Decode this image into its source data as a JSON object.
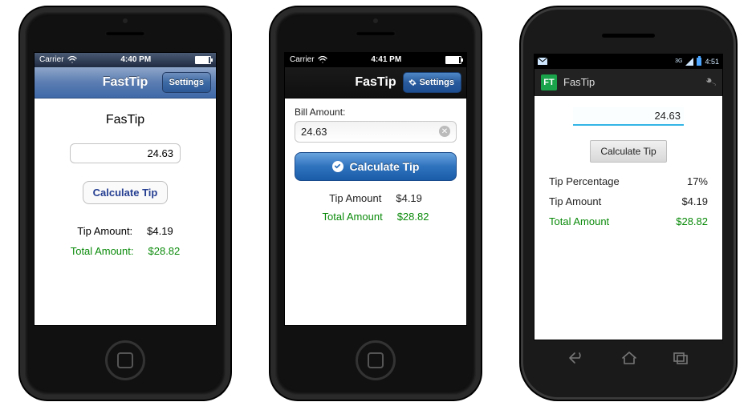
{
  "ios_old": {
    "carrier": "Carrier",
    "time": "4:40 PM",
    "nav_title": "FastTip",
    "settings_label": "Settings",
    "page_title": "FasTip",
    "bill_value": "24.63",
    "calc_label": "Calculate Tip",
    "tip_label": "Tip Amount:",
    "tip_value": "$4.19",
    "total_label": "Total Amount:",
    "total_value": "$28.82"
  },
  "ios_new": {
    "carrier": "Carrier",
    "time": "4:41 PM",
    "nav_title": "FasTip",
    "settings_label": "Settings",
    "bill_label": "Bill Amount:",
    "bill_value": "24.63",
    "calc_label": "Calculate Tip",
    "tip_label": "Tip Amount",
    "tip_value": "$4.19",
    "total_label": "Total Amount",
    "total_value": "$28.82"
  },
  "android": {
    "time": "4:51",
    "net_label": "3G",
    "app_logo": "FT",
    "app_name": "FasTip",
    "bill_value": "24.63",
    "calc_label": "Calculate Tip",
    "pct_label": "Tip Percentage",
    "pct_value": "17%",
    "tip_label": "Tip Amount",
    "tip_value": "$4.19",
    "total_label": "Total Amount",
    "total_value": "$28.82"
  }
}
